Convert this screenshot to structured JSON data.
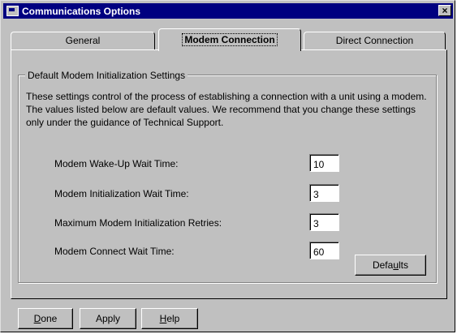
{
  "window": {
    "title": "Communications Options",
    "close_glyph": "×"
  },
  "tabs": [
    {
      "label": "General"
    },
    {
      "label": "Modem Connection"
    },
    {
      "label": "Direct Connection"
    }
  ],
  "active_tab": "Modem Connection",
  "group": {
    "title": "Default Modem Initialization Settings",
    "description": "These settings control of the process of establishing a connection with a unit using a modem.  The values listed below are default values.  We recommend that you change these settings only under the guidance of Technical Support."
  },
  "fields": [
    {
      "label": "Modem Wake-Up Wait Time:",
      "value": "10"
    },
    {
      "label": "Modem Initialization Wait Time:",
      "value": "3"
    },
    {
      "label": "Maximum Modem Initialization Retries:",
      "value": "3"
    },
    {
      "label": "Modem Connect Wait Time:",
      "value": "60"
    }
  ],
  "defaults_button": {
    "pre": "Defa",
    "mnemonic": "u",
    "post": "lts"
  },
  "footer_buttons": {
    "done": {
      "mnemonic": "D",
      "rest": "one"
    },
    "apply": {
      "label": "Apply"
    },
    "help": {
      "mnemonic": "H",
      "rest": "elp"
    }
  }
}
